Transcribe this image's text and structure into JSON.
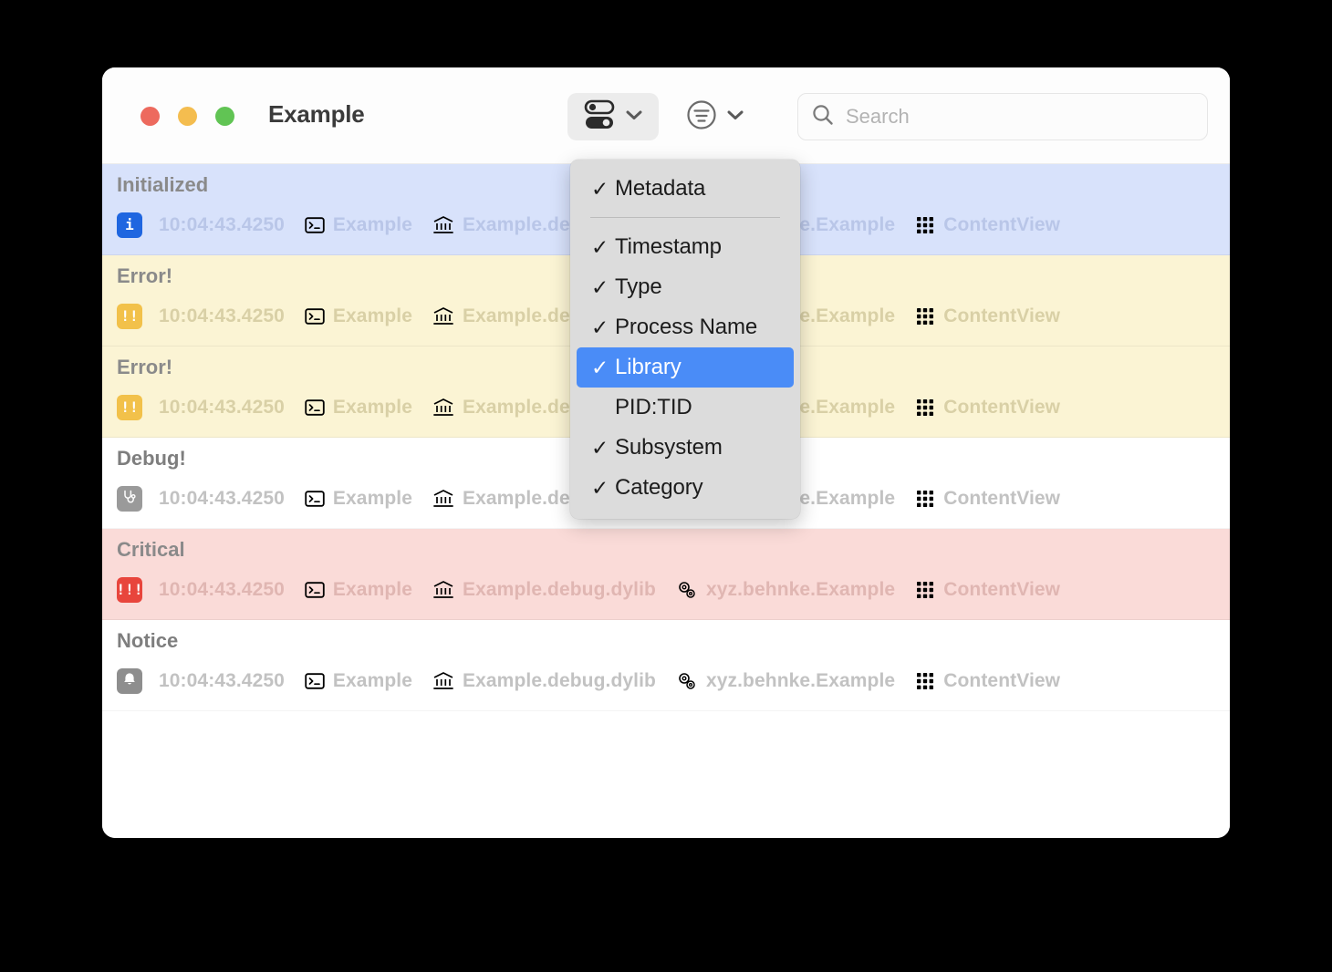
{
  "window": {
    "title": "Example",
    "traffic_lights": [
      {
        "name": "close",
        "color": "#ed6a5e"
      },
      {
        "name": "minimize",
        "color": "#f4bd4f"
      },
      {
        "name": "zoom",
        "color": "#61c454"
      }
    ]
  },
  "toolbar": {
    "toggles_button": {
      "icon": "switches-icon",
      "chevron": "chevron-down-icon",
      "active": true
    },
    "filter_button": {
      "icon": "filter-lines-circle-icon",
      "chevron": "chevron-down-icon"
    },
    "search": {
      "icon": "search-icon",
      "value": "",
      "placeholder": "Search"
    }
  },
  "menu": {
    "items": [
      {
        "label": "Metadata",
        "checked": true,
        "selected": false,
        "separator_after": true
      },
      {
        "label": "Timestamp",
        "checked": true,
        "selected": false,
        "separator_after": false
      },
      {
        "label": "Type",
        "checked": true,
        "selected": false,
        "separator_after": false
      },
      {
        "label": "Process Name",
        "checked": true,
        "selected": false,
        "separator_after": false
      },
      {
        "label": "Library",
        "checked": true,
        "selected": true,
        "separator_after": false
      },
      {
        "label": "PID:TID",
        "checked": false,
        "selected": false,
        "separator_after": false
      },
      {
        "label": "Subsystem",
        "checked": true,
        "selected": false,
        "separator_after": false
      },
      {
        "label": "Category",
        "checked": true,
        "selected": false,
        "separator_after": false
      }
    ],
    "check_glyph": "✓",
    "highlight_color": "#4a8cf7"
  },
  "log_rows": [
    {
      "message": "Initialized",
      "level": "info",
      "badge_glyph": "i",
      "badge_color": "#1f66e0",
      "row_color": "#d8e2fb",
      "timestamp": "10:04:43.4250",
      "process": "Example",
      "library": "Example.debug.dylib",
      "subsystem": "xyz.behnke.Example",
      "category": "ContentView"
    },
    {
      "message": "Error!",
      "level": "error",
      "badge_glyph": "!!",
      "badge_color": "#f2c14a",
      "row_color": "#fbf4d4",
      "timestamp": "10:04:43.4250",
      "process": "Example",
      "library": "Example.debug.dylib",
      "subsystem": "xyz.behnke.Example",
      "category": "ContentView"
    },
    {
      "message": "Error!",
      "level": "error",
      "badge_glyph": "!!",
      "badge_color": "#f2c14a",
      "row_color": "#fbf4d4",
      "timestamp": "10:04:43.4250",
      "process": "Example",
      "library": "Example.debug.dylib",
      "subsystem": "xyz.behnke.Example",
      "category": "ContentView"
    },
    {
      "message": "Debug!",
      "level": "debug",
      "badge_glyph": "stethoscope-icon",
      "badge_color": "#9a9a9a",
      "row_color": "#ffffff",
      "timestamp": "10:04:43.4250",
      "process": "Example",
      "library": "Example.debug.dylib",
      "subsystem": "xyz.behnke.Example",
      "category": "ContentView"
    },
    {
      "message": "Critical",
      "level": "critical",
      "badge_glyph": "!!!",
      "badge_color": "#e8453c",
      "row_color": "#fadbd8",
      "timestamp": "10:04:43.4250",
      "process": "Example",
      "library": "Example.debug.dylib",
      "subsystem": "xyz.behnke.Example",
      "category": "ContentView"
    },
    {
      "message": "Notice",
      "level": "notice",
      "badge_glyph": "bell-icon",
      "badge_color": "#8e8e8e",
      "row_color": "#ffffff",
      "timestamp": "10:04:43.4250",
      "process": "Example",
      "library": "Example.debug.dylib",
      "subsystem": "xyz.behnke.Example",
      "category": "ContentView"
    }
  ],
  "column_icons": {
    "process": "terminal-icon",
    "library": "bank-columns-icon",
    "subsystem": "gears-icon",
    "category": "grid-squares-icon"
  }
}
